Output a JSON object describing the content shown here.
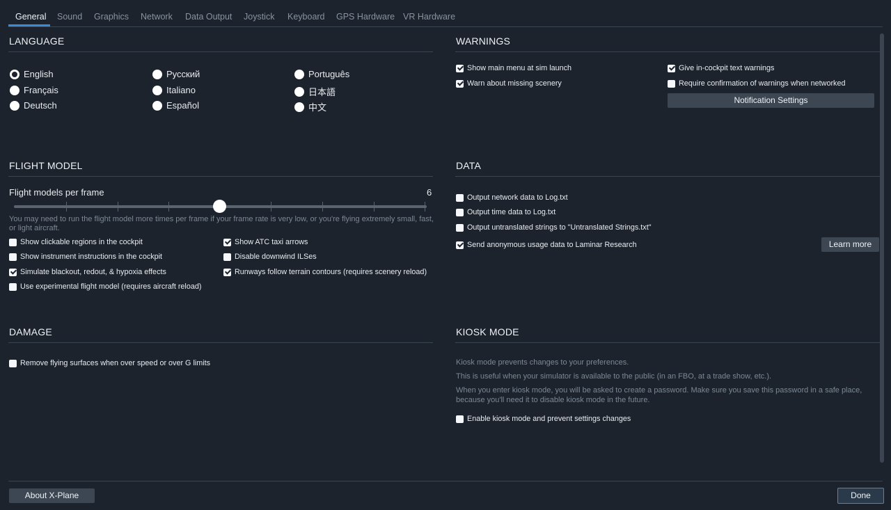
{
  "tabs": [
    {
      "label": "General"
    },
    {
      "label": "Sound"
    },
    {
      "label": "Graphics"
    },
    {
      "label": "Network"
    },
    {
      "label": "Data Output"
    },
    {
      "label": "Joystick"
    },
    {
      "label": "Keyboard"
    },
    {
      "label": "GPS Hardware"
    },
    {
      "label": "VR Hardware"
    }
  ],
  "language": {
    "title": "LANGUAGE",
    "options": [
      {
        "label": "English",
        "selected": true
      },
      {
        "label": "Français"
      },
      {
        "label": "Deutsch"
      },
      {
        "label": "Русский"
      },
      {
        "label": "Italiano"
      },
      {
        "label": "Español"
      },
      {
        "label": "Português"
      },
      {
        "label": "日本語"
      },
      {
        "label": "中文"
      }
    ]
  },
  "warnings": {
    "title": "WARNINGS",
    "items": [
      {
        "label": "Show main menu at sim launch",
        "checked": true
      },
      {
        "label": "Warn about missing scenery",
        "checked": true
      },
      {
        "label": "Give in-cockpit text warnings",
        "checked": true
      },
      {
        "label": "Require confirmation of warnings when networked",
        "checked": false
      }
    ],
    "notification_button": "Notification Settings"
  },
  "flight_model": {
    "title": "FLIGHT MODEL",
    "slider_label": "Flight models per frame",
    "slider_value": "6",
    "hint": "You may need to run the flight model more times per frame if your frame rate is very low, or you're flying extremely small, fast, or light aircraft.",
    "items": [
      {
        "label": "Show clickable regions in the cockpit",
        "checked": false
      },
      {
        "label": "Show instrument instructions in the cockpit",
        "checked": false
      },
      {
        "label": "Simulate blackout, redout, & hypoxia effects",
        "checked": true
      },
      {
        "label": "Use experimental flight model (requires aircraft reload)",
        "checked": false
      },
      {
        "label": "Show ATC taxi arrows",
        "checked": true
      },
      {
        "label": "Disable downwind ILSes",
        "checked": false
      },
      {
        "label": "Runways follow terrain contours (requires scenery reload)",
        "checked": true
      }
    ]
  },
  "data": {
    "title": "DATA",
    "items": [
      {
        "label": "Output network data to Log.txt",
        "checked": false
      },
      {
        "label": "Output time data to Log.txt",
        "checked": false
      },
      {
        "label": "Output untranslated strings to \"Untranslated Strings.txt\"",
        "checked": false
      },
      {
        "label": "Send anonymous usage data to Laminar Research",
        "checked": true
      }
    ],
    "learn_more": "Learn more"
  },
  "damage": {
    "title": "DAMAGE",
    "items": [
      {
        "label": "Remove flying surfaces when over speed or over G limits",
        "checked": false
      }
    ]
  },
  "kiosk": {
    "title": "KIOSK MODE",
    "line1": "Kiosk mode prevents changes to your preferences.",
    "line2": "This is useful when your simulator is available to the public (in an FBO, at a trade show, etc.).",
    "line3": "When you enter kiosk mode, you will be asked to create a password. Make sure you save this password in a safe place,",
    "line4": "because you'll need it to disable kiosk mode in the future.",
    "checkbox": {
      "label": "Enable kiosk mode and prevent settings changes",
      "checked": false
    }
  },
  "footer": {
    "about": "About X-Plane",
    "done": "Done"
  },
  "colors": {
    "background": "#1c232c",
    "accent": "#3a8ad8",
    "button": "#3d4753"
  }
}
